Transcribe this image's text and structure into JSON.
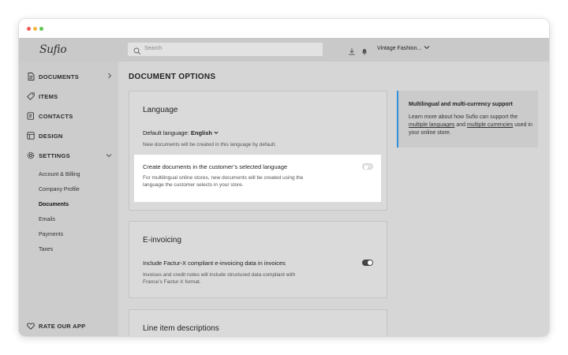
{
  "sidebar": {
    "logo": "Sufio",
    "nav": [
      {
        "label": "DOCUMENTS",
        "icon": "document-icon"
      },
      {
        "label": "ITEMS",
        "icon": "tag-icon"
      },
      {
        "label": "CONTACTS",
        "icon": "contacts-icon"
      },
      {
        "label": "DESIGN",
        "icon": "design-icon"
      },
      {
        "label": "SETTINGS",
        "icon": "gear-icon"
      }
    ],
    "settings_sub": [
      "Account & Billing",
      "Company Profile",
      "Documents",
      "Emails",
      "Payments",
      "Taxes"
    ],
    "rate": "RATE OUR APP"
  },
  "topbar": {
    "search_placeholder": "Search",
    "store_name": "Vintage Fashion..."
  },
  "main": {
    "page_title": "DOCUMENT OPTIONS",
    "language": {
      "title": "Language",
      "default_label": "Default language:",
      "default_value": "English",
      "default_desc": "New documents will be created in this language by default.",
      "customer_toggle_label": "Create documents in the customer’s selected language",
      "customer_toggle_desc_1": "For multilingual online stores, new documents will be created using the",
      "customer_toggle_desc_2": "language the customer selects in your store.",
      "customer_toggle_on": false
    },
    "einvoicing": {
      "title": "E-invoicing",
      "toggle_label": "Include Factur-X compliant e-invoicing data in invoices",
      "desc_1": "Invoices and credit notes will include structured data compliant with",
      "desc_2": "France’s Factur-X format.",
      "toggle_on": true
    },
    "line_items": {
      "title": "Line item descriptions"
    }
  },
  "info": {
    "title": "Multilingual and multi-currency support",
    "text_1": "Learn more about how Sufio can support the",
    "link_1": "multiple languages",
    "and": " and ",
    "link_2": "multiple currencies",
    "text_2": "used in your online store."
  }
}
